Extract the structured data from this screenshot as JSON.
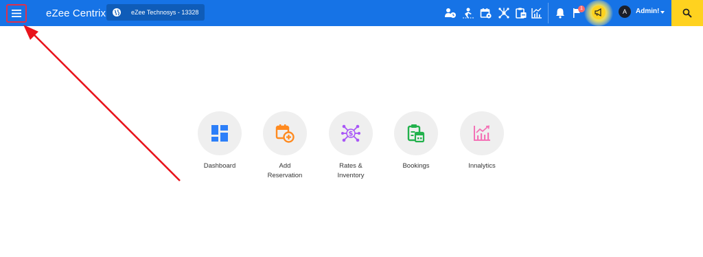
{
  "header": {
    "app_name": "eZee Centrix",
    "property_name": "eZee Technosys -  13328",
    "notification_count": "1",
    "user_initial": "A",
    "user_name": "Admin!",
    "brand_color": "#1673e6",
    "accent_color": "#ffd21f",
    "toolbar_icons": [
      "guest-time-icon",
      "walk-in-icon",
      "calendar-settings-icon",
      "network-icon",
      "clipboard-icon",
      "analytics-icon",
      "bell-icon",
      "flag-icon",
      "megaphone-icon"
    ]
  },
  "dashboard_tiles": [
    {
      "label": "Dashboard",
      "icon": "dashboard-grid-icon",
      "color": "#2d7ff9"
    },
    {
      "label": "Add\nReservation",
      "icon": "add-reservation-icon",
      "color": "#ff8a1f"
    },
    {
      "label": "Rates &\nInventory",
      "icon": "rates-inventory-icon",
      "color": "#a855f7"
    },
    {
      "label": "Bookings",
      "icon": "bookings-icon",
      "color": "#22b14c"
    },
    {
      "label": "Innalytics",
      "icon": "innalytics-icon",
      "color": "#f472b6"
    }
  ]
}
